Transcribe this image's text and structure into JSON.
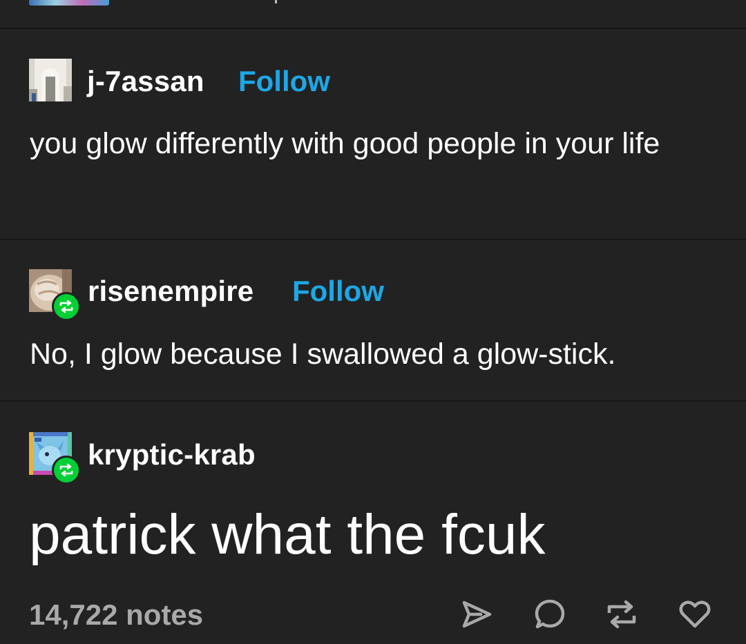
{
  "posts": [
    {
      "username": "j-7assan",
      "follow_label": "Follow",
      "text": "you glow differently with good people in your life"
    },
    {
      "username": "risenempire",
      "follow_label": "Follow",
      "text": "No, I glow because I swallowed a glow-stick.",
      "reblog": true
    },
    {
      "username": "kryptic-krab",
      "text": "patrick what the fcuk",
      "reblog": true
    }
  ],
  "footer": {
    "notes": "14,722 notes",
    "actions": [
      "share-icon",
      "reply-icon",
      "reblog-icon",
      "like-icon"
    ]
  },
  "colors": {
    "background": "#222222",
    "follow_blue": "#1da7e6",
    "reblog_green": "#00cf35",
    "notes_gray": "#a9a9a9"
  }
}
